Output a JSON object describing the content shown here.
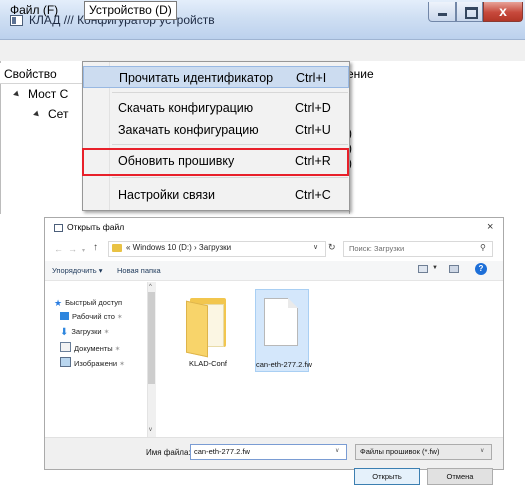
{
  "main_window": {
    "title": "КЛАД /// Конфигуратор устройств",
    "close_glyph": "x",
    "menu": {
      "file": "Файл (F)",
      "device": "Устройство (D)"
    },
    "grid": {
      "col_property": "Свойство",
      "col_value_fragment": "ение",
      "row1": "Мост С",
      "row2": "Сет",
      "value_fragments": [
        ")",
        ")",
        ")"
      ]
    },
    "dropdown": [
      {
        "label": "Прочитать идентификатор",
        "shortcut": "Ctrl+I"
      },
      {
        "label": "Скачать конфигурацию",
        "shortcut": "Ctrl+D"
      },
      {
        "label": "Закачать конфигурацию",
        "shortcut": "Ctrl+U"
      },
      {
        "label": "Обновить прошивку",
        "shortcut": "Ctrl+R"
      },
      {
        "label": "Настройки связи",
        "shortcut": "Ctrl+C"
      }
    ],
    "highlight_color": "#e8202a"
  },
  "open_dialog": {
    "title": "Открыть файл",
    "close_glyph": "×",
    "address": "« Windows 10 (D:) › Загрузки",
    "search_placeholder": "Поиск: Загрузки",
    "toolbar": {
      "organize": "Упорядочить ▾",
      "new_folder": "Новая папка",
      "help": "?"
    },
    "nav": [
      {
        "label": "Быстрый доступ",
        "icon": "star-icon"
      },
      {
        "label": "Рабочий сто",
        "icon": "desktop-icon"
      },
      {
        "label": "Загрузки",
        "icon": "download-arrow-icon"
      },
      {
        "label": "Документы",
        "icon": "documents-icon"
      },
      {
        "label": "Изображени",
        "icon": "images-icon"
      }
    ],
    "files": [
      {
        "name": "KLAD-Conf",
        "icon": "folder-icon"
      },
      {
        "name": "can-eth-277.2.fw",
        "icon": "file-icon",
        "selected": true
      }
    ],
    "filename_label": "Имя файла:",
    "filename_value": "can-eth-277.2.fw",
    "filetype": "Файлы прошивок (*.fw)",
    "buttons": {
      "open": "Открыть",
      "cancel": "Отмена"
    }
  }
}
